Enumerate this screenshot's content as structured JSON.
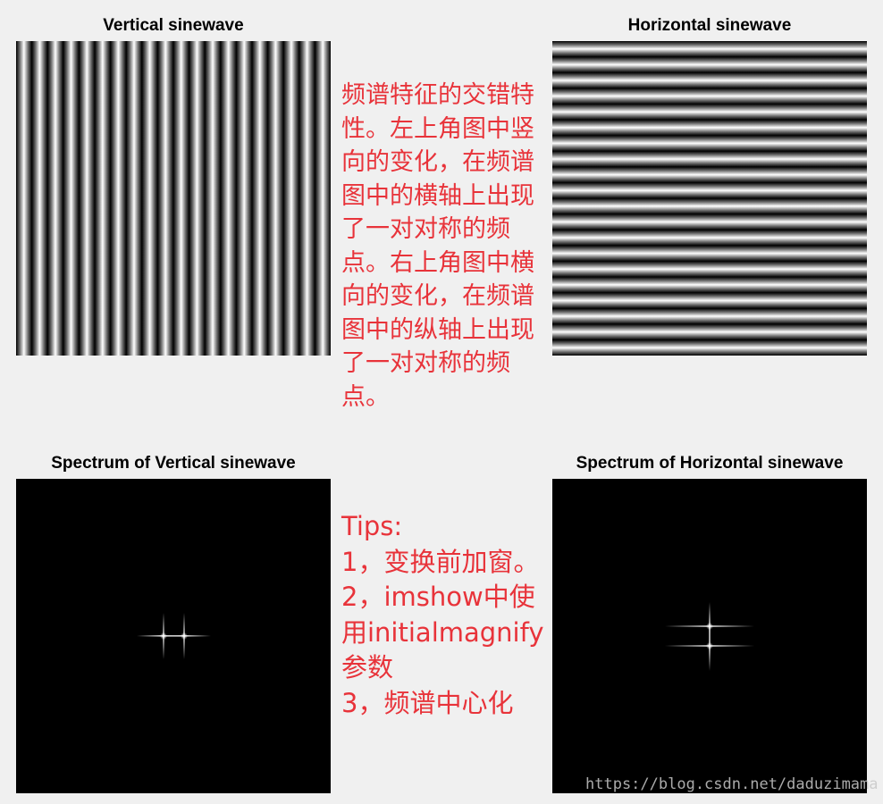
{
  "panels": {
    "top_left_title": "Vertical sinewave",
    "top_right_title": "Horizontal sinewave",
    "bottom_left_title": "Spectrum of Vertical sinewave",
    "bottom_right_title": "Spectrum of Horizontal sinewave"
  },
  "annotation": {
    "paragraph": "频谱特征的交错特性。左上角图中竖向的变化，在频谱图中的横轴上出现了一对对称的频点。右上角图中横向的变化，在频谱图中的纵轴上出现了一对对称的频点。",
    "tips_heading": "Tips:",
    "tips": [
      "1，变换前加窗。",
      "2，imshow中使",
      "用initialmagnify",
      "参数",
      "3，频谱中心化"
    ]
  },
  "watermark": "https://blog.csdn.net/daduzimama",
  "colors": {
    "background": "#f0f0f0",
    "annotation_text": "#e8333a"
  }
}
